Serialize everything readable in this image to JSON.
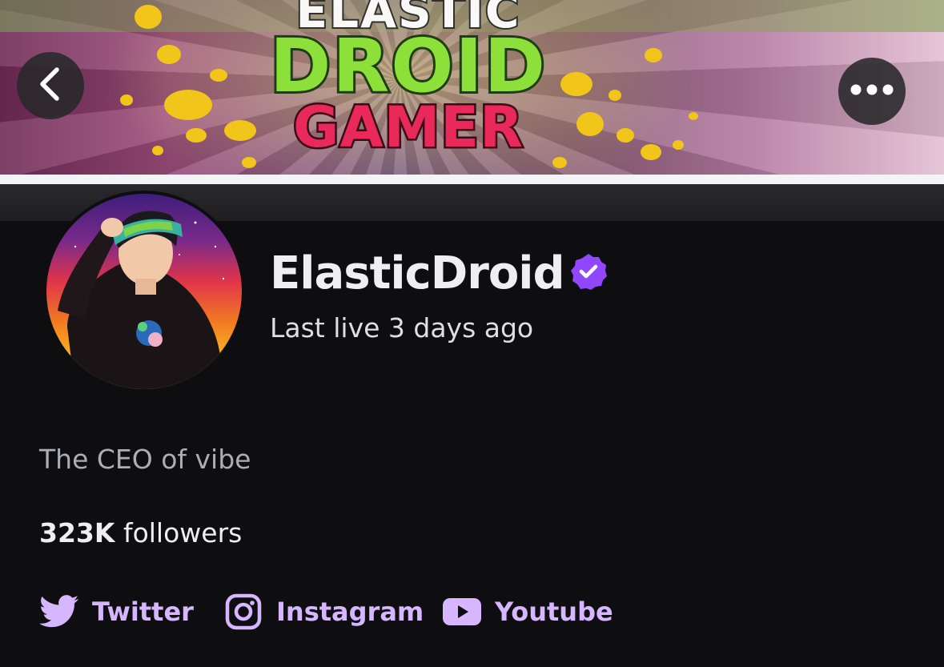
{
  "banner": {
    "logo_line1": "ELASTIC",
    "logo_line2": "DROID",
    "logo_line3": "GAMER"
  },
  "nav": {
    "back_icon": "chevron-left-icon",
    "more_icon": "more-horizontal-icon"
  },
  "profile": {
    "channel_name": "ElasticDroid",
    "verified_icon": "verified-badge-icon",
    "last_live": "Last live 3 days ago",
    "bio": "The CEO of vibe",
    "followers_count": "323K",
    "followers_label": " followers"
  },
  "social_links": [
    {
      "label": "Twitter",
      "icon": "twitter-icon"
    },
    {
      "label": "Instagram",
      "icon": "instagram-icon"
    },
    {
      "label": "Youtube",
      "icon": "youtube-icon"
    }
  ],
  "colors": {
    "background": "#0e0e10",
    "accent_purple": "#9147ff",
    "link_purple": "#d5b6ff",
    "text_primary": "#efeff1",
    "text_secondary": "#adadb8"
  }
}
